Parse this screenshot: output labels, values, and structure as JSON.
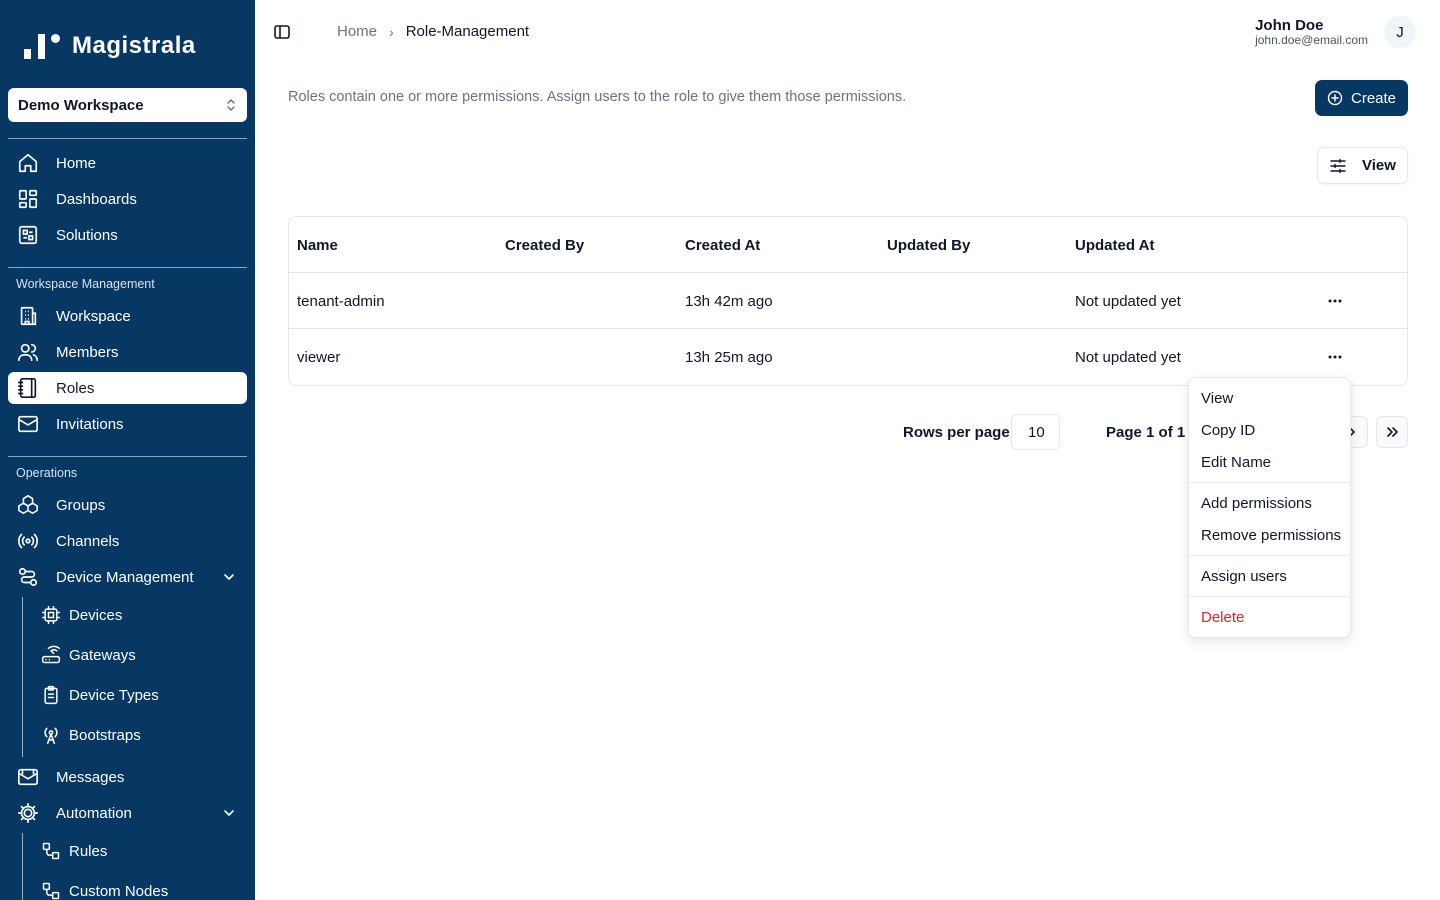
{
  "brand": {
    "name": "Magistrala"
  },
  "workspace": {
    "selected": "Demo Workspace"
  },
  "nav": {
    "main": [
      {
        "label": "Home",
        "icon": "home-icon"
      },
      {
        "label": "Dashboards",
        "icon": "dashboard-icon"
      },
      {
        "label": "Solutions",
        "icon": "solutions-icon"
      }
    ],
    "workspace_section": "Workspace Management",
    "workspace_items": [
      {
        "label": "Workspace",
        "icon": "building-icon"
      },
      {
        "label": "Members",
        "icon": "users-icon"
      },
      {
        "label": "Roles",
        "icon": "notebook-icon",
        "active": true
      },
      {
        "label": "Invitations",
        "icon": "mail-icon"
      }
    ],
    "operations_section": "Operations",
    "operations_items": [
      {
        "label": "Groups",
        "icon": "boxes-icon"
      },
      {
        "label": "Channels",
        "icon": "radio-icon"
      },
      {
        "label": "Device Management",
        "icon": "route-icon"
      }
    ],
    "device_items": [
      {
        "label": "Devices",
        "icon": "cpu-icon"
      },
      {
        "label": "Gateways",
        "icon": "router-icon"
      },
      {
        "label": "Device Types",
        "icon": "clipboard-icon"
      },
      {
        "label": "Bootstraps",
        "icon": "antenna-icon"
      }
    ],
    "messages": {
      "label": "Messages",
      "icon": "mail-open-icon"
    },
    "automation": {
      "label": "Automation",
      "icon": "cog-icon"
    },
    "automation_items": [
      {
        "label": "Rules",
        "icon": "workflow-icon"
      },
      {
        "label": "Custom Nodes",
        "icon": "workflow-icon"
      }
    ]
  },
  "header": {
    "breadcrumb_home": "Home",
    "breadcrumb_current": "Role-Management",
    "user_name": "John Doe",
    "user_email": "john.doe@email.com",
    "avatar_initial": "J"
  },
  "page": {
    "description": "Roles contain one or more permissions. Assign users to the role to give them those permissions.",
    "create_label": "Create",
    "view_label": "View"
  },
  "table": {
    "columns": [
      "Name",
      "Created By",
      "Created At",
      "Updated By",
      "Updated At"
    ],
    "rows": [
      {
        "name": "tenant-admin",
        "created_by": "",
        "created_at": "13h 42m ago",
        "updated_by": "",
        "updated_at": "Not updated yet"
      },
      {
        "name": "viewer",
        "created_by": "",
        "created_at": "13h 25m ago",
        "updated_by": "",
        "updated_at": "Not updated yet"
      }
    ]
  },
  "pagination": {
    "rows_per_page_label": "Rows per page",
    "rows_per_page": "10",
    "page_label": "Page 1 of 1"
  },
  "menu": {
    "view": "View",
    "copy_id": "Copy ID",
    "edit_name": "Edit Name",
    "add_permissions": "Add permissions",
    "remove_permissions": "Remove permissions",
    "assign_users": "Assign users",
    "delete": "Delete"
  },
  "colors": {
    "sidebar": "#073763",
    "primary": "#073763",
    "danger": "#dc2626"
  }
}
